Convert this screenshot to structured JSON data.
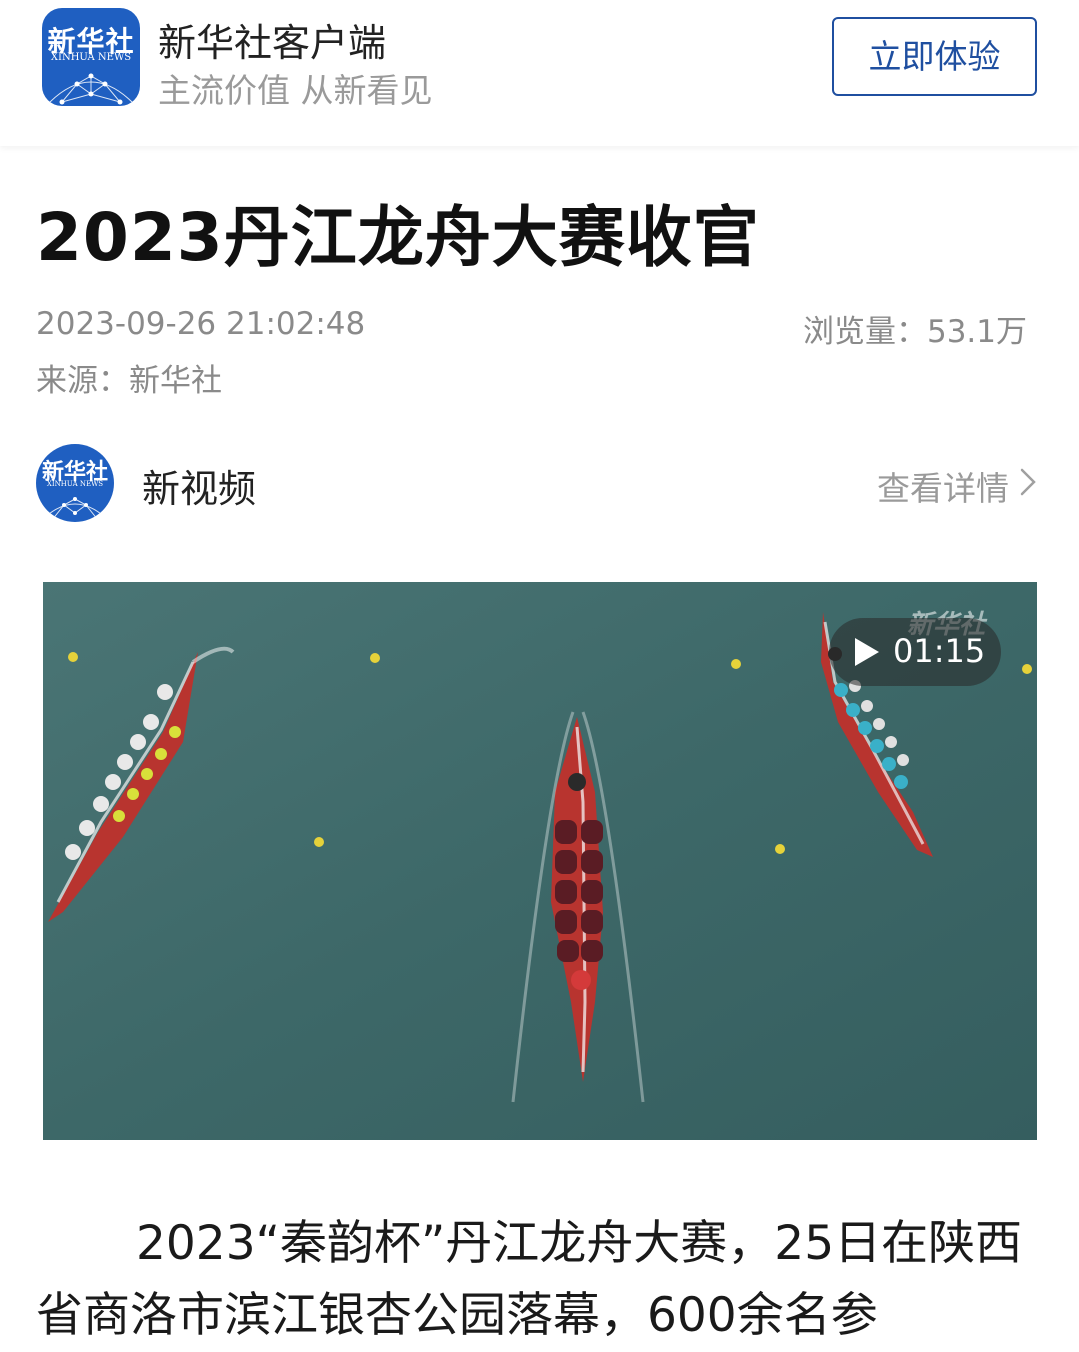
{
  "header": {
    "app_logo_text": "新华社",
    "app_logo_subtext": "XINHUA NEWS",
    "app_name": "新华社客户端",
    "slogan": "主流价值 从新看见",
    "cta_label": "立即体验"
  },
  "article": {
    "title": "2023丹江龙舟大赛收官",
    "publish_time": "2023-09-26 21:02:48",
    "views": "浏览量：53.1万",
    "source": "来源：新华社"
  },
  "channel": {
    "avatar_text": "新华社",
    "avatar_subtext": "XINHUA NEWS",
    "name": "新视频",
    "details_label": "查看详情"
  },
  "video": {
    "duration": "01:15",
    "watermark": "新华社",
    "icon": "play-icon"
  },
  "body": {
    "paragraph": "2023“秦韵杯”丹江龙舟大赛，25日在陕西省商洛市滨江银杏公园落幕，600余名参"
  },
  "colors": {
    "brand_blue": "#1f5fc1",
    "cta_border": "#1f4fa0",
    "meta_gray": "#8a8a8a",
    "water": "#3f6a6a"
  }
}
